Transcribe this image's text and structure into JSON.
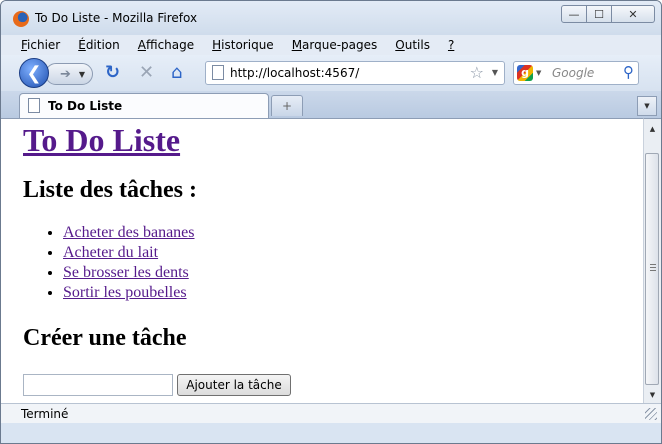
{
  "window": {
    "title": "To Do Liste - Mozilla Firefox",
    "controls": {
      "minimize": "—",
      "maximize": "☐",
      "close": "✕"
    }
  },
  "menubar": {
    "items": [
      {
        "pre": "",
        "u": "F",
        "post": "ichier"
      },
      {
        "pre": "",
        "u": "É",
        "post": "dition"
      },
      {
        "pre": "",
        "u": "A",
        "post": "ffichage"
      },
      {
        "pre": "",
        "u": "H",
        "post": "istorique"
      },
      {
        "pre": "",
        "u": "M",
        "post": "arque-pages"
      },
      {
        "pre": "",
        "u": "O",
        "post": "utils"
      },
      {
        "pre": "",
        "u": "?",
        "post": ""
      }
    ]
  },
  "navbar": {
    "url": "http://localhost:4567/",
    "search_placeholder": "Google",
    "icons": [
      "back-arrow",
      "forward-arrow",
      "reload",
      "stop",
      "home",
      "star",
      "google",
      "magnifier"
    ]
  },
  "tabs": {
    "active_label": "To Do Liste",
    "new_tab": "+"
  },
  "page": {
    "title": "To Do Liste",
    "tasks_heading": "Liste des tâches :",
    "tasks": [
      "Acheter des bananes",
      "Acheter du lait",
      "Se brosser les dents",
      "Sortir les poubelles"
    ],
    "create_heading": "Créer une tâche",
    "input_value": "",
    "add_button": "Ajouter la tâche",
    "link_color": "#551a8b"
  },
  "status": {
    "text": "Terminé"
  }
}
